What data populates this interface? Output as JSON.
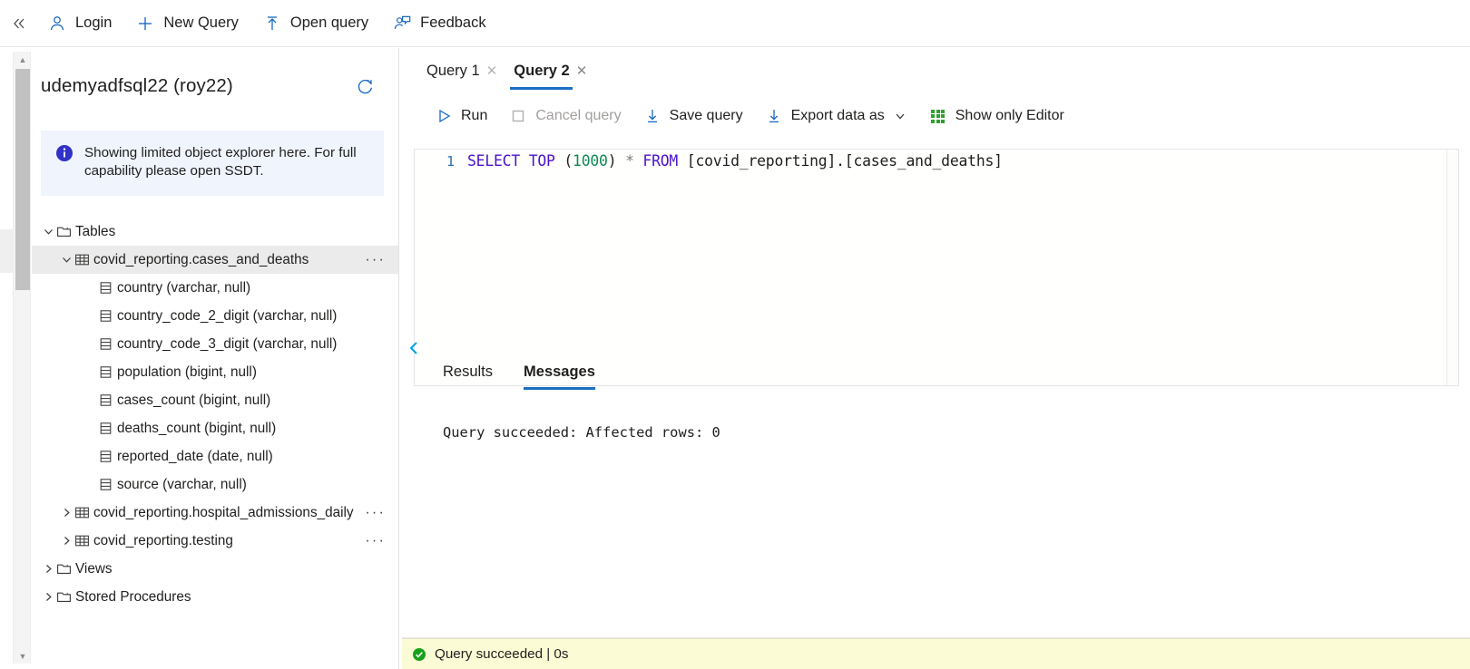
{
  "commandbar": {
    "collapse_icon": "double-chevron-left-icon",
    "items": [
      {
        "label": "Login",
        "icon": "person-icon"
      },
      {
        "label": "New Query",
        "icon": "plus-icon"
      },
      {
        "label": "Open query",
        "icon": "upload-arrow-icon"
      },
      {
        "label": "Feedback",
        "icon": "person-feedback-icon"
      }
    ]
  },
  "explorer": {
    "database_title": "udemyadfsql22 (roy22)",
    "refresh_icon": "refresh-icon",
    "info": {
      "icon": "info-icon",
      "text": "Showing limited object explorer here. For full capability please open SSDT."
    },
    "tree": [
      {
        "label": "Tables",
        "icon": "folder-icon",
        "chevron": "down",
        "indent": 0,
        "selected": false,
        "menu": false
      },
      {
        "label": "covid_reporting.cases_and_deaths",
        "icon": "table-icon",
        "chevron": "down",
        "indent": 1,
        "selected": true,
        "menu": true
      },
      {
        "label": "country (varchar, null)",
        "icon": "column-icon",
        "chevron": "none",
        "indent": 2,
        "selected": false,
        "menu": false
      },
      {
        "label": "country_code_2_digit (varchar, null)",
        "icon": "column-icon",
        "chevron": "none",
        "indent": 2,
        "selected": false,
        "menu": false
      },
      {
        "label": "country_code_3_digit (varchar, null)",
        "icon": "column-icon",
        "chevron": "none",
        "indent": 2,
        "selected": false,
        "menu": false
      },
      {
        "label": "population (bigint, null)",
        "icon": "column-icon",
        "chevron": "none",
        "indent": 2,
        "selected": false,
        "menu": false
      },
      {
        "label": "cases_count (bigint, null)",
        "icon": "column-icon",
        "chevron": "none",
        "indent": 2,
        "selected": false,
        "menu": false
      },
      {
        "label": "deaths_count (bigint, null)",
        "icon": "column-icon",
        "chevron": "none",
        "indent": 2,
        "selected": false,
        "menu": false
      },
      {
        "label": "reported_date (date, null)",
        "icon": "column-icon",
        "chevron": "none",
        "indent": 2,
        "selected": false,
        "menu": false
      },
      {
        "label": "source (varchar, null)",
        "icon": "column-icon",
        "chevron": "none",
        "indent": 2,
        "selected": false,
        "menu": false
      },
      {
        "label": "covid_reporting.hospital_admissions_daily",
        "icon": "table-icon",
        "chevron": "right",
        "indent": 1,
        "selected": false,
        "menu": true
      },
      {
        "label": "covid_reporting.testing",
        "icon": "table-icon",
        "chevron": "right",
        "indent": 1,
        "selected": false,
        "menu": true
      },
      {
        "label": "Views",
        "icon": "folder-icon",
        "chevron": "right",
        "indent": 0,
        "selected": false,
        "menu": false
      },
      {
        "label": "Stored Procedures",
        "icon": "folder-icon",
        "chevron": "right",
        "indent": 0,
        "selected": false,
        "menu": false
      }
    ]
  },
  "query": {
    "tabs": [
      {
        "label": "Query 1",
        "active": false,
        "close_icon": "close-icon"
      },
      {
        "label": "Query 2",
        "active": true,
        "close_icon": "close-icon"
      }
    ],
    "toolbar": [
      {
        "label": "Run",
        "icon": "play-icon",
        "disabled": false
      },
      {
        "label": "Cancel query",
        "icon": "stop-square-icon",
        "disabled": true
      },
      {
        "label": "Save query",
        "icon": "download-arrow-icon",
        "disabled": false
      },
      {
        "label": "Export data as",
        "icon": "download-arrow-icon",
        "disabled": false,
        "has_chevron": true
      },
      {
        "label": "Show only Editor",
        "icon": "grid-icon",
        "disabled": false
      }
    ],
    "editor": {
      "line_number": "1",
      "tokens": [
        {
          "text": "SELECT",
          "type": "keyword"
        },
        {
          "text": " ",
          "type": "plain"
        },
        {
          "text": "TOP",
          "type": "keyword"
        },
        {
          "text": " (",
          "type": "plain"
        },
        {
          "text": "1000",
          "type": "number"
        },
        {
          "text": ") ",
          "type": "plain"
        },
        {
          "text": "*",
          "type": "operator"
        },
        {
          "text": " ",
          "type": "plain"
        },
        {
          "text": "FROM",
          "type": "keyword"
        },
        {
          "text": " [covid_reporting].[cases_and_deaths]",
          "type": "plain"
        }
      ],
      "full_text": "SELECT TOP (1000) * FROM [covid_reporting].[cases_and_deaths]"
    },
    "collapse_icon": "chevron-left-icon",
    "result_tabs": [
      {
        "label": "Results",
        "active": false
      },
      {
        "label": "Messages",
        "active": true
      }
    ],
    "message": "Query succeeded: Affected rows: 0"
  },
  "statusbar": {
    "icon": "success-check-icon",
    "text": "Query succeeded | 0s",
    "background": "#fbfbd5"
  },
  "colors": {
    "accent": "#1b6ec2",
    "icon_blue": "#1668c5",
    "keyword": "#4b13c9",
    "number": "#0e8a55",
    "success_green": "#17a01c",
    "selected_row": "#ebebeb",
    "info_bg": "#eff4fd"
  }
}
